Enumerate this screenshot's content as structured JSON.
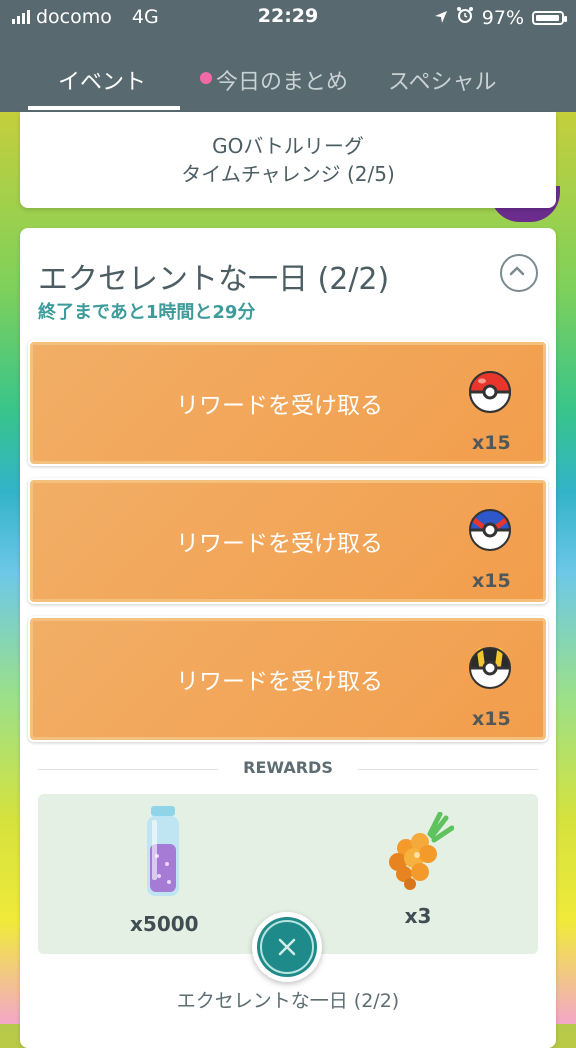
{
  "status_bar": {
    "carrier": "docomo",
    "network": "4G",
    "time": "22:29",
    "battery": "97%"
  },
  "tabs": [
    {
      "label": "イベント",
      "active": true
    },
    {
      "label": "今日のまとめ",
      "active": false,
      "has_dot": true
    },
    {
      "label": "スペシャル",
      "active": false
    }
  ],
  "top_card": {
    "line1": "GOバトルリーグ",
    "line2": "タイムチャレンジ (2/5)"
  },
  "research_card": {
    "title": "エクセレントな一日 (2/2)",
    "subtitle": "終了まであと1時間と29分",
    "reward_buttons": [
      {
        "label": "リワードを受け取る",
        "item_icon": "poke-ball-icon",
        "quantity": "x15"
      },
      {
        "label": "リワードを受け取る",
        "item_icon": "great-ball-icon",
        "quantity": "x15"
      },
      {
        "label": "リワードを受け取る",
        "item_icon": "ultra-ball-icon",
        "quantity": "x15"
      }
    ],
    "rewards_header": "REWARDS",
    "rewards": [
      {
        "icon": "stardust-icon",
        "quantity": "x5000"
      },
      {
        "icon": "golden-razz-berry-icon",
        "quantity": "x3"
      }
    ]
  },
  "close_button_icon": "close-icon",
  "bottom_label": "エクセレントな一日 (2/2)",
  "colors": {
    "header": "#58696f",
    "reward_button": "#f2a85a",
    "subtitle_teal": "#3d9b9b",
    "close_button": "#1f8a8a"
  }
}
